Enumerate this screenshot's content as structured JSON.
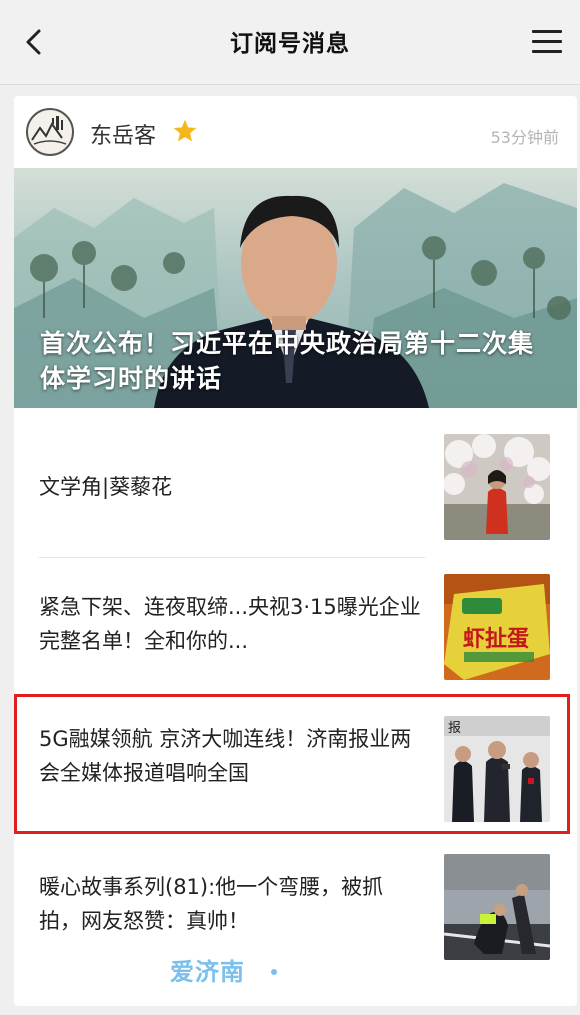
{
  "navbar": {
    "title": "订阅号消息"
  },
  "account": {
    "name": "东岳客",
    "time": "53分钟前"
  },
  "hero": {
    "title": "首次公布！习近平在中央政治局第十二次集体学习时的讲话"
  },
  "articles": [
    {
      "title": "文学角|葵藜花"
    },
    {
      "title": "紧急下架、连夜取缔...央视3·15曝光企业完整名单！全和你的..."
    },
    {
      "title": "5G融媒领航 京济大咖连线！济南报业两会全媒体报道唱响全国"
    },
    {
      "title": "暖心故事系列(81):他一个弯腰，被抓拍，网友怒赞：真帅！"
    }
  ],
  "watermark": {
    "text": "爱济南"
  },
  "colors": {
    "highlight": "#e01e1e",
    "star": "#f5b81c",
    "watermark": "#7ac0ec"
  }
}
